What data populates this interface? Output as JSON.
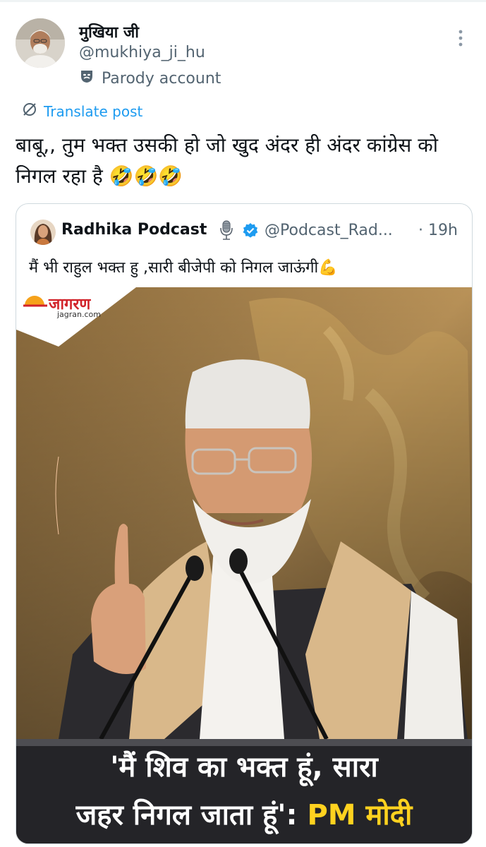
{
  "author": {
    "display_name": "मुखिया जी",
    "handle": "@mukhiya_ji_hu",
    "label": "Parody account"
  },
  "translate_label": "Translate post",
  "tweet_text": "बाबू,, तुम भक्त उसकी हो जो खुद अंदर ही अंदर कांग्रेस को निगल रहा है 🤣🤣🤣",
  "quoted": {
    "display_name": "Radhika Podcast",
    "handle": "@Podcast_Rad...",
    "time": "· 19h",
    "text": "मैं भी राहुल भक्त हु ,सारी बीजेपी को निगल जाऊंगी💪",
    "image": {
      "logo_text": "जागरण",
      "logo_sub": "jagran.com",
      "caption_line1": "'मैं शिव का भक्त हूं, सारा",
      "caption_line2_pre": "जहर निगल जाता हूं':",
      "caption_line2_highlight": "PM मोदी"
    }
  },
  "colors": {
    "link": "#1d9bf0",
    "secondary_text": "#536471",
    "verified": "#1d9bf0",
    "caption_highlight": "#ffd21f"
  }
}
